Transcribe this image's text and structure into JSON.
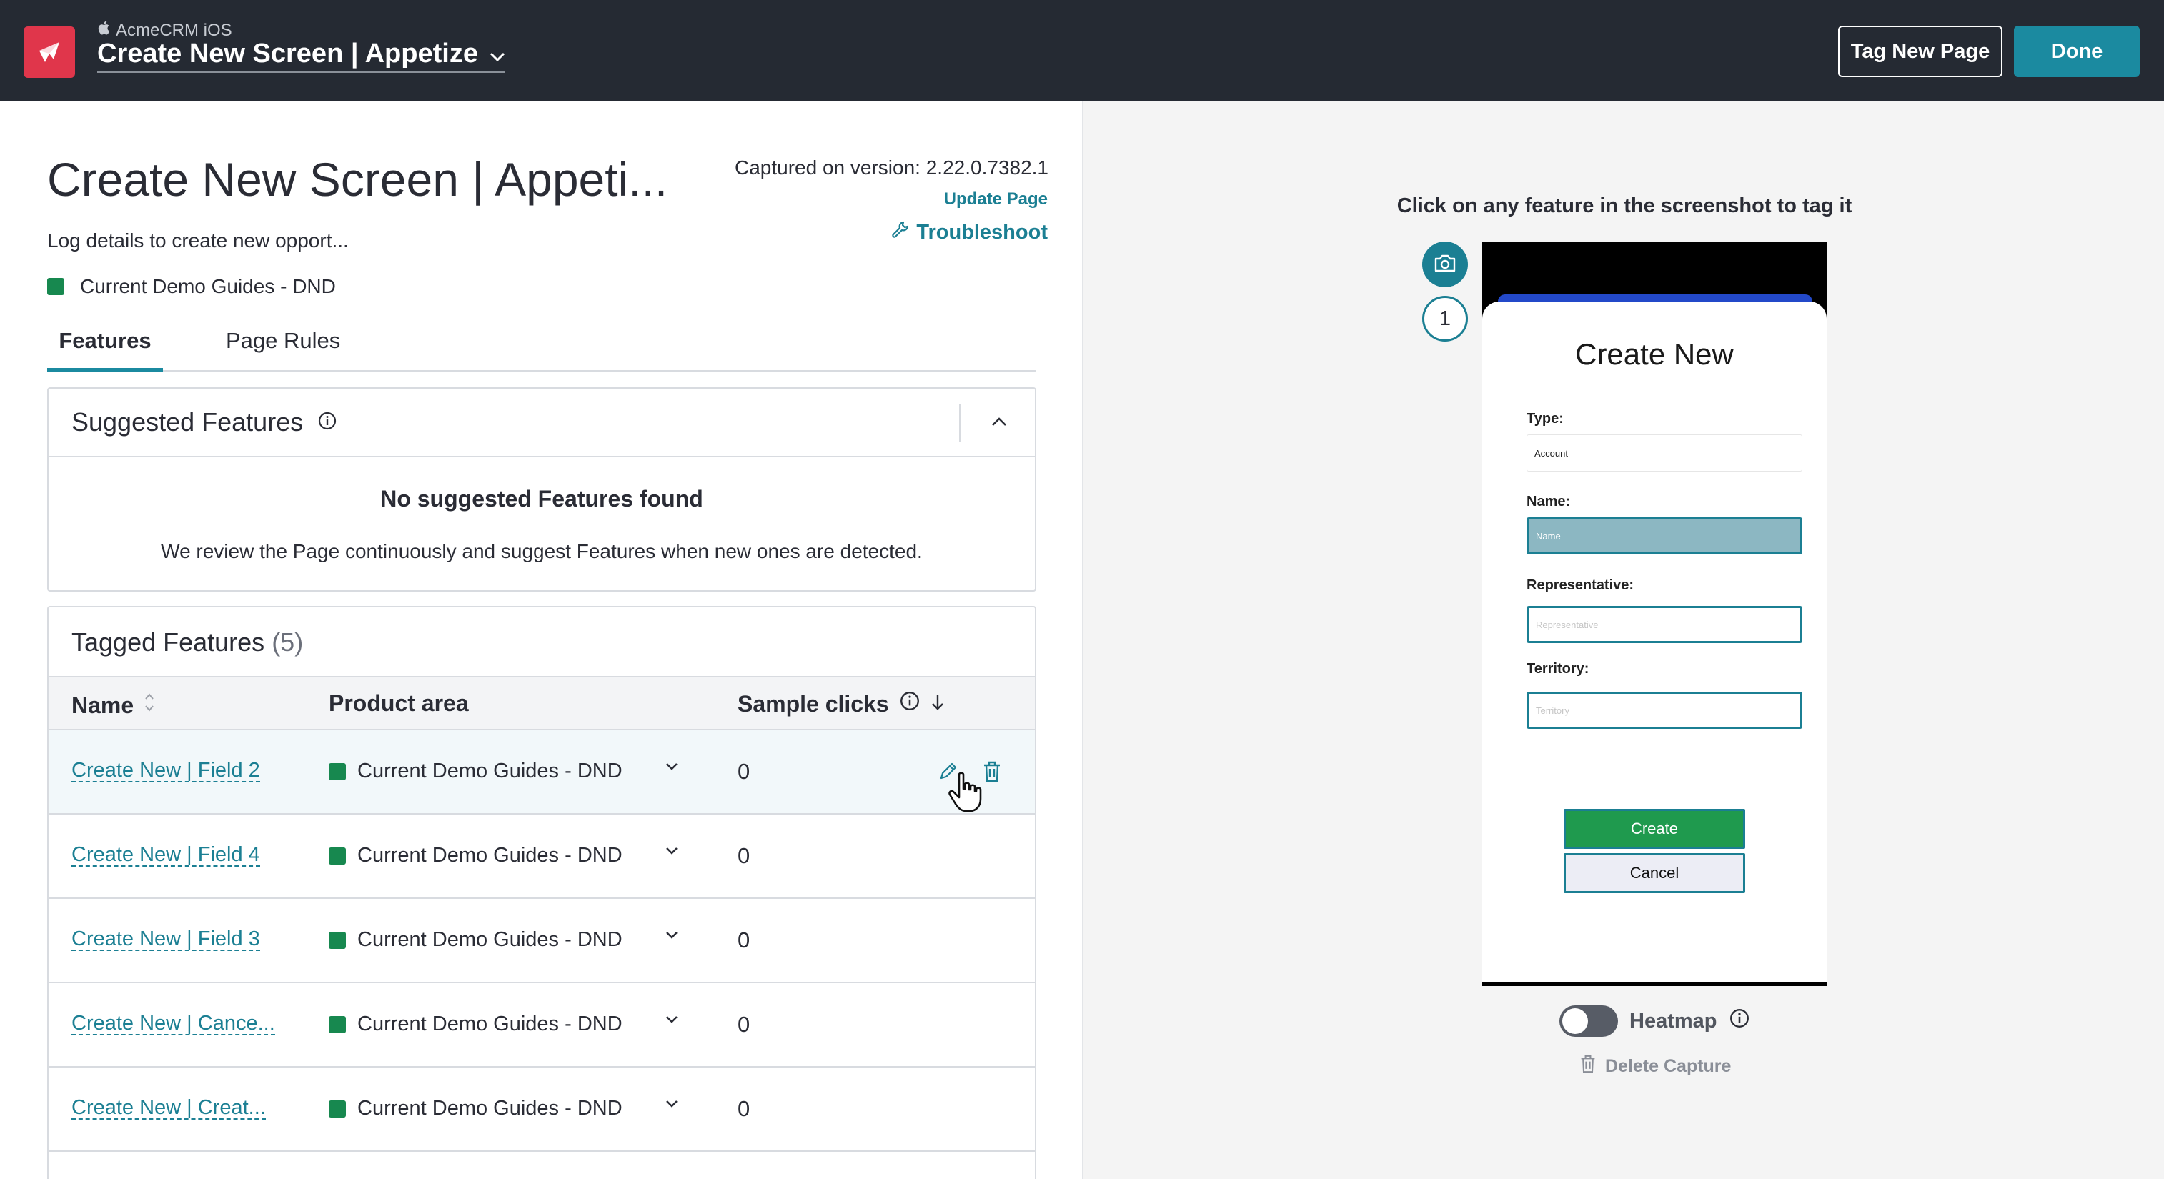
{
  "topbar": {
    "app_name": "AcmeCRM iOS",
    "page_selector": "Create New Screen | Appetize",
    "tag_new_page": "Tag New Page",
    "done": "Done"
  },
  "page": {
    "title": "Create New Screen | Appeti...",
    "description": "Log details to create new opport...",
    "product_area": "Current Demo Guides - DND",
    "captured_on": "Captured on version: 2.22.0.7382.1",
    "update_page": "Update Page",
    "troubleshoot": "Troubleshoot"
  },
  "tabs": [
    "Features",
    "Page Rules"
  ],
  "suggested": {
    "title": "Suggested Features",
    "empty_title": "No suggested Features found",
    "empty_desc": "We review the Page continuously and suggest Features when new ones are detected."
  },
  "tagged": {
    "title": "Tagged Features",
    "count": "(5)",
    "columns": {
      "name": "Name",
      "area": "Product area",
      "clicks": "Sample clicks"
    },
    "rows": [
      {
        "name": "Create New | Field 2",
        "area": "Current Demo Guides - DND",
        "clicks": "0"
      },
      {
        "name": "Create New | Field 4",
        "area": "Current Demo Guides - DND",
        "clicks": "0"
      },
      {
        "name": "Create New | Field 3",
        "area": "Current Demo Guides - DND",
        "clicks": "0"
      },
      {
        "name": "Create New | Cance...",
        "area": "Current Demo Guides - DND",
        "clicks": "0"
      },
      {
        "name": "Create New | Creat...",
        "area": "Current Demo Guides - DND",
        "clicks": "0"
      }
    ]
  },
  "preview": {
    "instruction": "Click on any feature in the screenshot to tag it",
    "capture_number": "1",
    "phone": {
      "title": "Create New",
      "type_label": "Type:",
      "type_value": "Account",
      "name_label": "Name:",
      "name_placeholder": "Name",
      "rep_label": "Representative:",
      "rep_placeholder": "Representative",
      "territory_label": "Territory:",
      "territory_placeholder": "Territory",
      "create": "Create",
      "cancel": "Cancel"
    },
    "heatmap": "Heatmap",
    "delete_capture": "Delete Capture"
  },
  "colors": {
    "topbar_bg": "#252a33",
    "brand": "#e0364b",
    "accent": "#1b8aa0",
    "link": "#1b7f93",
    "product_area": "#17884f"
  },
  "icons": [
    "apple-icon",
    "chevron-down-icon",
    "wrench-icon",
    "info-icon",
    "chevron-up-icon",
    "sort-icon",
    "arrow-down-icon",
    "pencil-icon",
    "trash-icon",
    "camera-icon",
    "hand-cursor-icon"
  ]
}
